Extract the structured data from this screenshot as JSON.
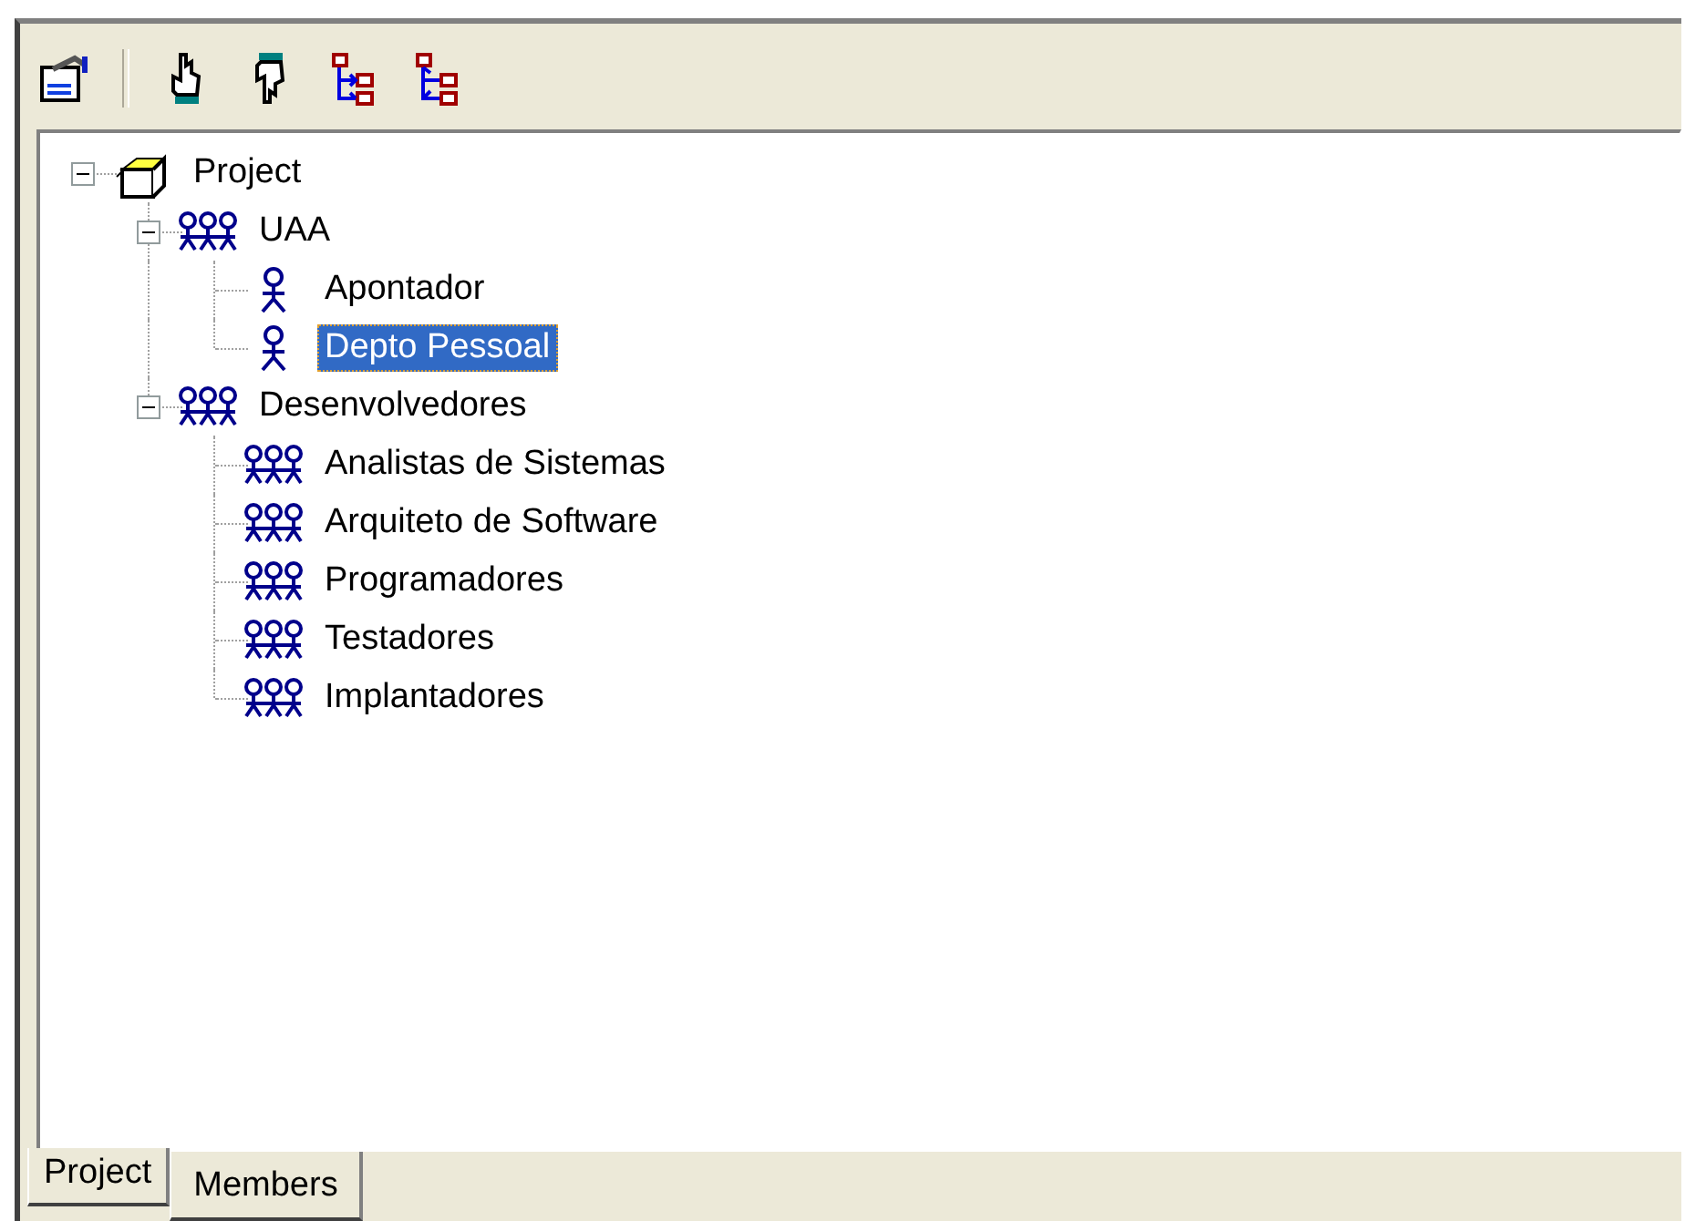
{
  "toolbar": {
    "buttons": [
      {
        "kind": "properties"
      },
      {
        "kind": "separator"
      },
      {
        "kind": "hand-up"
      },
      {
        "kind": "hand-down"
      },
      {
        "kind": "tree-expand"
      },
      {
        "kind": "tree-collapse"
      }
    ]
  },
  "tree": [
    {
      "label": "Project",
      "kind": "project",
      "expanded": true,
      "selected": false,
      "children": [
        {
          "label": "UAA",
          "kind": "group",
          "expanded": true,
          "selected": false,
          "children": [
            {
              "label": "Apontador",
              "kind": "person",
              "selected": false
            },
            {
              "label": "Depto Pessoal",
              "kind": "person",
              "selected": true
            }
          ]
        },
        {
          "label": "Desenvolvedores",
          "kind": "group",
          "expanded": true,
          "selected": false,
          "children": [
            {
              "label": "Analistas de Sistemas",
              "kind": "group",
              "selected": false
            },
            {
              "label": "Arquiteto de Software",
              "kind": "group",
              "selected": false
            },
            {
              "label": "Programadores",
              "kind": "group",
              "selected": false
            },
            {
              "label": "Testadores",
              "kind": "group",
              "selected": false
            },
            {
              "label": "Implantadores",
              "kind": "group",
              "selected": false
            }
          ]
        }
      ]
    }
  ],
  "tabs": [
    {
      "label": "Project",
      "selected": false
    },
    {
      "label": "Members",
      "selected": true
    }
  ]
}
